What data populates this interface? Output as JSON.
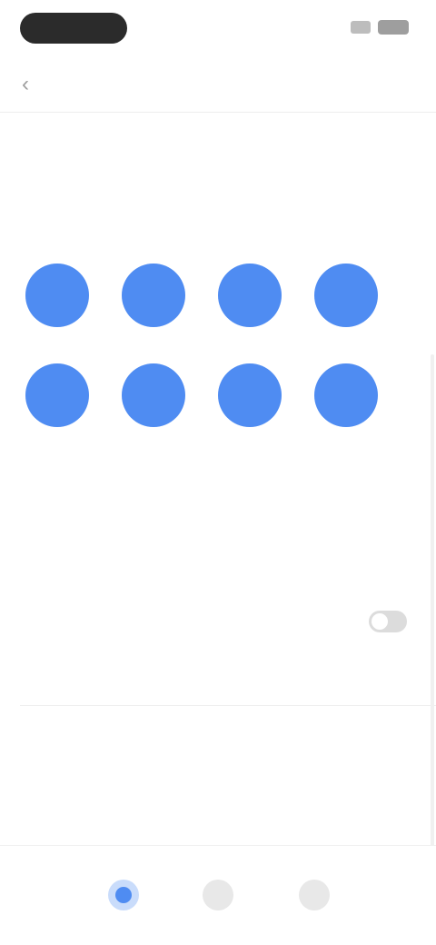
{
  "header": {
    "title": "",
    "back_icon": "chevron-left-icon",
    "action_label": ""
  },
  "balance": {
    "label": "",
    "value": ""
  },
  "actions_section": {
    "title": "",
    "items": [
      {
        "label": "",
        "icon": "action-icon"
      },
      {
        "label": "",
        "icon": "action-icon"
      },
      {
        "label": "",
        "icon": "action-icon"
      },
      {
        "label": "",
        "icon": "action-icon"
      },
      {
        "label": "",
        "icon": "action-icon"
      },
      {
        "label": "",
        "icon": "action-icon"
      },
      {
        "label": "",
        "icon": "action-icon"
      },
      {
        "label": "",
        "icon": "action-icon"
      }
    ]
  },
  "entitlements": {
    "title": "",
    "row_label": "",
    "row_description": ""
  },
  "details": {
    "title": "",
    "rows": [
      {
        "key": "",
        "value": ""
      },
      {
        "key": "",
        "value": ""
      }
    ]
  },
  "colors": {
    "accent": "#4f8cf2",
    "text": "#5f6368",
    "muted": "#c2c2c2"
  },
  "bottom_nav": [
    {
      "icon": "home-icon",
      "active": true
    },
    {
      "icon": "list-icon",
      "active": false
    },
    {
      "icon": "profile-icon",
      "active": false
    }
  ]
}
